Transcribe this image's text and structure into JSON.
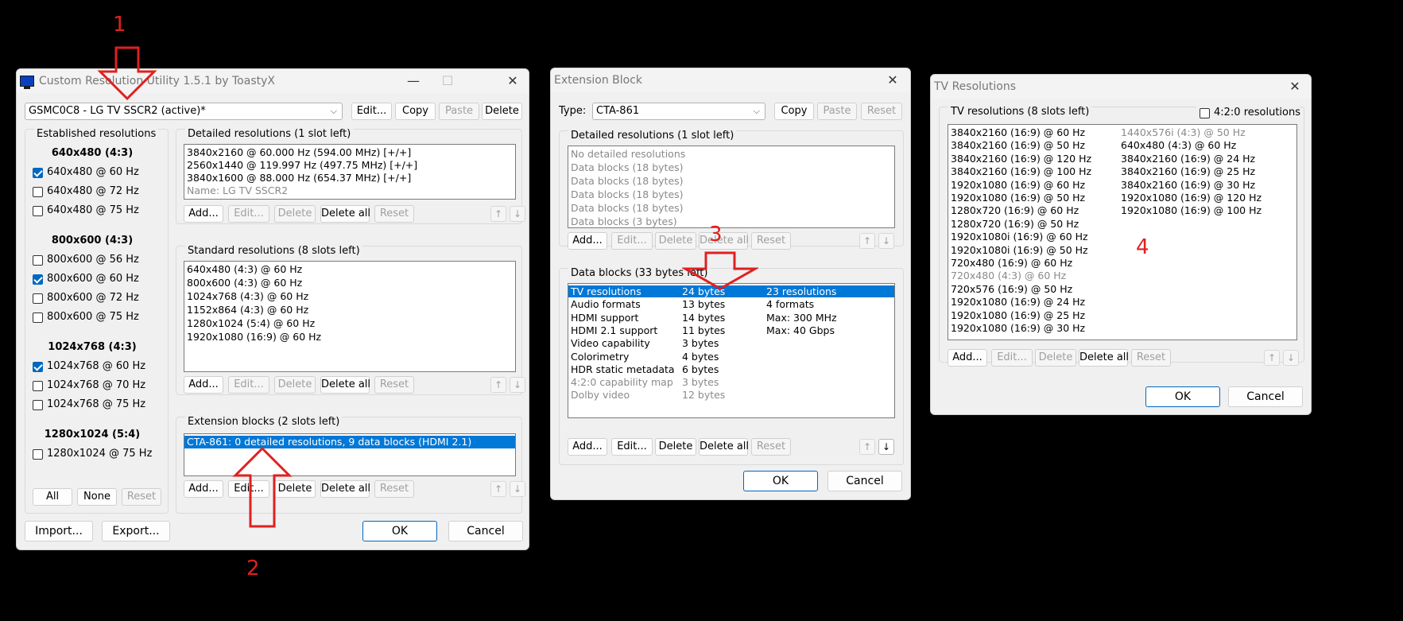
{
  "annotations": [
    "1",
    "2",
    "3",
    "4"
  ],
  "main": {
    "title": "Custom Resolution Utility 1.5.1 by ToastyX",
    "display": "GSMC0C8 - LG TV SSCR2 (active)*",
    "buttons": {
      "edit": "Edit...",
      "copy": "Copy",
      "paste": "Paste",
      "delete": "Delete"
    },
    "established": {
      "title": "Established resolutions",
      "groups": [
        {
          "heading": "640x480 (4:3)",
          "items": [
            {
              "label": "640x480 @ 60 Hz",
              "checked": true
            },
            {
              "label": "640x480 @ 72 Hz",
              "checked": false
            },
            {
              "label": "640x480 @ 75 Hz",
              "checked": false
            }
          ]
        },
        {
          "heading": "800x600 (4:3)",
          "items": [
            {
              "label": "800x600 @ 56 Hz",
              "checked": false
            },
            {
              "label": "800x600 @ 60 Hz",
              "checked": true
            },
            {
              "label": "800x600 @ 72 Hz",
              "checked": false
            },
            {
              "label": "800x600 @ 75 Hz",
              "checked": false
            }
          ]
        },
        {
          "heading": "1024x768 (4:3)",
          "items": [
            {
              "label": "1024x768 @ 60 Hz",
              "checked": true
            },
            {
              "label": "1024x768 @ 70 Hz",
              "checked": false
            },
            {
              "label": "1024x768 @ 75 Hz",
              "checked": false
            }
          ]
        },
        {
          "heading": "1280x1024 (5:4)",
          "items": [
            {
              "label": "1280x1024 @ 75 Hz",
              "checked": false
            }
          ]
        }
      ],
      "buttons": {
        "all": "All",
        "none": "None",
        "reset": "Reset"
      }
    },
    "detailed": {
      "title": "Detailed resolutions (1 slot left)",
      "rows": [
        "3840x2160 @ 60.000 Hz (594.00 MHz) [+/+]",
        "2560x1440 @ 119.997 Hz (497.75 MHz) [+/+]",
        "3840x1600 @ 88.000 Hz (654.37 MHz) [+/+]",
        "Name: LG TV SSCR2"
      ]
    },
    "standard": {
      "title": "Standard resolutions (8 slots left)",
      "rows": [
        "640x480 (4:3) @ 60 Hz",
        "800x600 (4:3) @ 60 Hz",
        "1024x768 (4:3) @ 60 Hz",
        "1152x864 (4:3) @ 60 Hz",
        "1280x1024 (5:4) @ 60 Hz",
        "1920x1080 (16:9) @ 60 Hz"
      ]
    },
    "extension": {
      "title": "Extension blocks (2 slots left)",
      "rows": [
        "CTA-861: 0 detailed resolutions, 9 data blocks (HDMI 2.1)"
      ]
    },
    "listbuttons": {
      "add": "Add...",
      "edit": "Edit...",
      "delete": "Delete",
      "delete_all": "Delete all",
      "reset": "Reset",
      "up": "↑",
      "down": "↓"
    },
    "import": "Import...",
    "export": "Export...",
    "ok": "OK",
    "cancel": "Cancel"
  },
  "ext": {
    "title": "Extension Block",
    "type_label": "Type:",
    "type_value": "CTA-861",
    "buttons": {
      "copy": "Copy",
      "paste": "Paste",
      "reset": "Reset"
    },
    "detailed": {
      "title": "Detailed resolutions (1 slot left)",
      "rows": [
        "No detailed resolutions",
        "Data blocks (18 bytes)",
        "Data blocks (18 bytes)",
        "Data blocks (18 bytes)",
        "Data blocks (18 bytes)",
        "Data blocks (3 bytes)"
      ]
    },
    "datablocks": {
      "title": "Data blocks (33 bytes left)",
      "rows": [
        {
          "name": "TV resolutions",
          "size": "24 bytes",
          "info": "23 resolutions"
        },
        {
          "name": "Audio formats",
          "size": "13 bytes",
          "info": "4 formats"
        },
        {
          "name": "HDMI support",
          "size": "14 bytes",
          "info": "Max: 300 MHz"
        },
        {
          "name": "HDMI 2.1 support",
          "size": "11 bytes",
          "info": "Max: 40 Gbps"
        },
        {
          "name": "Video capability",
          "size": "3 bytes",
          "info": ""
        },
        {
          "name": "Colorimetry",
          "size": "4 bytes",
          "info": ""
        },
        {
          "name": "HDR static metadata",
          "size": "6 bytes",
          "info": ""
        },
        {
          "name": "4:2:0 capability map",
          "size": "3 bytes",
          "info": ""
        },
        {
          "name": "Dolby video",
          "size": "12 bytes",
          "info": ""
        }
      ]
    },
    "listbuttons": {
      "add": "Add...",
      "edit": "Edit...",
      "delete": "Delete",
      "delete_all": "Delete all",
      "reset": "Reset",
      "up": "↑",
      "down": "↓"
    },
    "ok": "OK",
    "cancel": "Cancel"
  },
  "tv": {
    "title": "TV Resolutions",
    "group_title": "TV resolutions (8 slots left)",
    "checkbox_420": "4:2:0 resolutions",
    "col1": [
      "3840x2160 (16:9) @ 60 Hz",
      "3840x2160 (16:9) @ 50 Hz",
      "3840x2160 (16:9) @ 120 Hz",
      "3840x2160 (16:9) @ 100 Hz",
      "1920x1080 (16:9) @ 60 Hz",
      "1920x1080 (16:9) @ 50 Hz",
      "1280x720 (16:9) @ 60 Hz",
      "1280x720 (16:9) @ 50 Hz",
      "1920x1080i (16:9) @ 60 Hz",
      "1920x1080i (16:9) @ 50 Hz",
      "720x480 (16:9) @ 60 Hz",
      "720x480 (4:3) @ 60 Hz",
      "720x576 (16:9) @ 50 Hz",
      "1920x1080 (16:9) @ 24 Hz",
      "1920x1080 (16:9) @ 25 Hz",
      "1920x1080 (16:9) @ 30 Hz"
    ],
    "col2": [
      "1440x576i (4:3) @ 50 Hz",
      "640x480 (4:3) @ 60 Hz",
      "3840x2160 (16:9) @ 24 Hz",
      "3840x2160 (16:9) @ 25 Hz",
      "3840x2160 (16:9) @ 30 Hz",
      "1920x1080 (16:9) @ 120 Hz",
      "1920x1080 (16:9) @ 100 Hz"
    ],
    "listbuttons": {
      "add": "Add...",
      "edit": "Edit...",
      "delete": "Delete",
      "delete_all": "Delete all",
      "reset": "Reset",
      "up": "↑",
      "down": "↓"
    },
    "ok": "OK",
    "cancel": "Cancel"
  }
}
